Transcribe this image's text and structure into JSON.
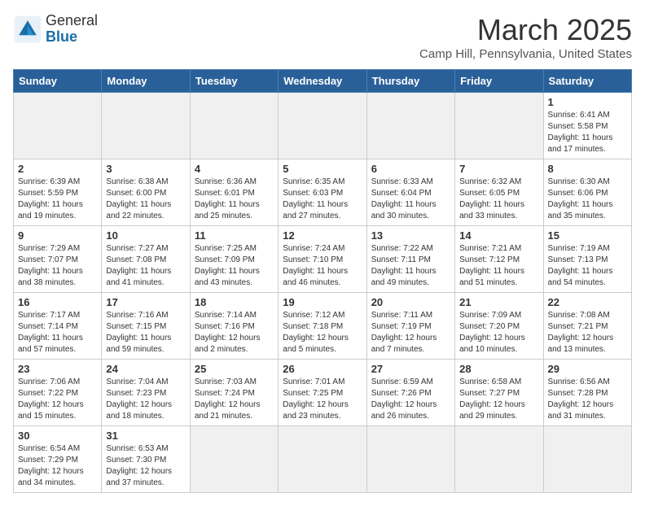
{
  "header": {
    "logo_general": "General",
    "logo_blue": "Blue",
    "month_title": "March 2025",
    "location": "Camp Hill, Pennsylvania, United States"
  },
  "weekdays": [
    "Sunday",
    "Monday",
    "Tuesday",
    "Wednesday",
    "Thursday",
    "Friday",
    "Saturday"
  ],
  "weeks": [
    [
      {
        "day": "",
        "info": ""
      },
      {
        "day": "",
        "info": ""
      },
      {
        "day": "",
        "info": ""
      },
      {
        "day": "",
        "info": ""
      },
      {
        "day": "",
        "info": ""
      },
      {
        "day": "",
        "info": ""
      },
      {
        "day": "1",
        "info": "Sunrise: 6:41 AM\nSunset: 5:58 PM\nDaylight: 11 hours\nand 17 minutes."
      }
    ],
    [
      {
        "day": "2",
        "info": "Sunrise: 6:39 AM\nSunset: 5:59 PM\nDaylight: 11 hours\nand 19 minutes."
      },
      {
        "day": "3",
        "info": "Sunrise: 6:38 AM\nSunset: 6:00 PM\nDaylight: 11 hours\nand 22 minutes."
      },
      {
        "day": "4",
        "info": "Sunrise: 6:36 AM\nSunset: 6:01 PM\nDaylight: 11 hours\nand 25 minutes."
      },
      {
        "day": "5",
        "info": "Sunrise: 6:35 AM\nSunset: 6:03 PM\nDaylight: 11 hours\nand 27 minutes."
      },
      {
        "day": "6",
        "info": "Sunrise: 6:33 AM\nSunset: 6:04 PM\nDaylight: 11 hours\nand 30 minutes."
      },
      {
        "day": "7",
        "info": "Sunrise: 6:32 AM\nSunset: 6:05 PM\nDaylight: 11 hours\nand 33 minutes."
      },
      {
        "day": "8",
        "info": "Sunrise: 6:30 AM\nSunset: 6:06 PM\nDaylight: 11 hours\nand 35 minutes."
      }
    ],
    [
      {
        "day": "9",
        "info": "Sunrise: 7:29 AM\nSunset: 7:07 PM\nDaylight: 11 hours\nand 38 minutes."
      },
      {
        "day": "10",
        "info": "Sunrise: 7:27 AM\nSunset: 7:08 PM\nDaylight: 11 hours\nand 41 minutes."
      },
      {
        "day": "11",
        "info": "Sunrise: 7:25 AM\nSunset: 7:09 PM\nDaylight: 11 hours\nand 43 minutes."
      },
      {
        "day": "12",
        "info": "Sunrise: 7:24 AM\nSunset: 7:10 PM\nDaylight: 11 hours\nand 46 minutes."
      },
      {
        "day": "13",
        "info": "Sunrise: 7:22 AM\nSunset: 7:11 PM\nDaylight: 11 hours\nand 49 minutes."
      },
      {
        "day": "14",
        "info": "Sunrise: 7:21 AM\nSunset: 7:12 PM\nDaylight: 11 hours\nand 51 minutes."
      },
      {
        "day": "15",
        "info": "Sunrise: 7:19 AM\nSunset: 7:13 PM\nDaylight: 11 hours\nand 54 minutes."
      }
    ],
    [
      {
        "day": "16",
        "info": "Sunrise: 7:17 AM\nSunset: 7:14 PM\nDaylight: 11 hours\nand 57 minutes."
      },
      {
        "day": "17",
        "info": "Sunrise: 7:16 AM\nSunset: 7:15 PM\nDaylight: 11 hours\nand 59 minutes."
      },
      {
        "day": "18",
        "info": "Sunrise: 7:14 AM\nSunset: 7:16 PM\nDaylight: 12 hours\nand 2 minutes."
      },
      {
        "day": "19",
        "info": "Sunrise: 7:12 AM\nSunset: 7:18 PM\nDaylight: 12 hours\nand 5 minutes."
      },
      {
        "day": "20",
        "info": "Sunrise: 7:11 AM\nSunset: 7:19 PM\nDaylight: 12 hours\nand 7 minutes."
      },
      {
        "day": "21",
        "info": "Sunrise: 7:09 AM\nSunset: 7:20 PM\nDaylight: 12 hours\nand 10 minutes."
      },
      {
        "day": "22",
        "info": "Sunrise: 7:08 AM\nSunset: 7:21 PM\nDaylight: 12 hours\nand 13 minutes."
      }
    ],
    [
      {
        "day": "23",
        "info": "Sunrise: 7:06 AM\nSunset: 7:22 PM\nDaylight: 12 hours\nand 15 minutes."
      },
      {
        "day": "24",
        "info": "Sunrise: 7:04 AM\nSunset: 7:23 PM\nDaylight: 12 hours\nand 18 minutes."
      },
      {
        "day": "25",
        "info": "Sunrise: 7:03 AM\nSunset: 7:24 PM\nDaylight: 12 hours\nand 21 minutes."
      },
      {
        "day": "26",
        "info": "Sunrise: 7:01 AM\nSunset: 7:25 PM\nDaylight: 12 hours\nand 23 minutes."
      },
      {
        "day": "27",
        "info": "Sunrise: 6:59 AM\nSunset: 7:26 PM\nDaylight: 12 hours\nand 26 minutes."
      },
      {
        "day": "28",
        "info": "Sunrise: 6:58 AM\nSunset: 7:27 PM\nDaylight: 12 hours\nand 29 minutes."
      },
      {
        "day": "29",
        "info": "Sunrise: 6:56 AM\nSunset: 7:28 PM\nDaylight: 12 hours\nand 31 minutes."
      }
    ],
    [
      {
        "day": "30",
        "info": "Sunrise: 6:54 AM\nSunset: 7:29 PM\nDaylight: 12 hours\nand 34 minutes."
      },
      {
        "day": "31",
        "info": "Sunrise: 6:53 AM\nSunset: 7:30 PM\nDaylight: 12 hours\nand 37 minutes."
      },
      {
        "day": "",
        "info": ""
      },
      {
        "day": "",
        "info": ""
      },
      {
        "day": "",
        "info": ""
      },
      {
        "day": "",
        "info": ""
      },
      {
        "day": "",
        "info": ""
      }
    ]
  ]
}
